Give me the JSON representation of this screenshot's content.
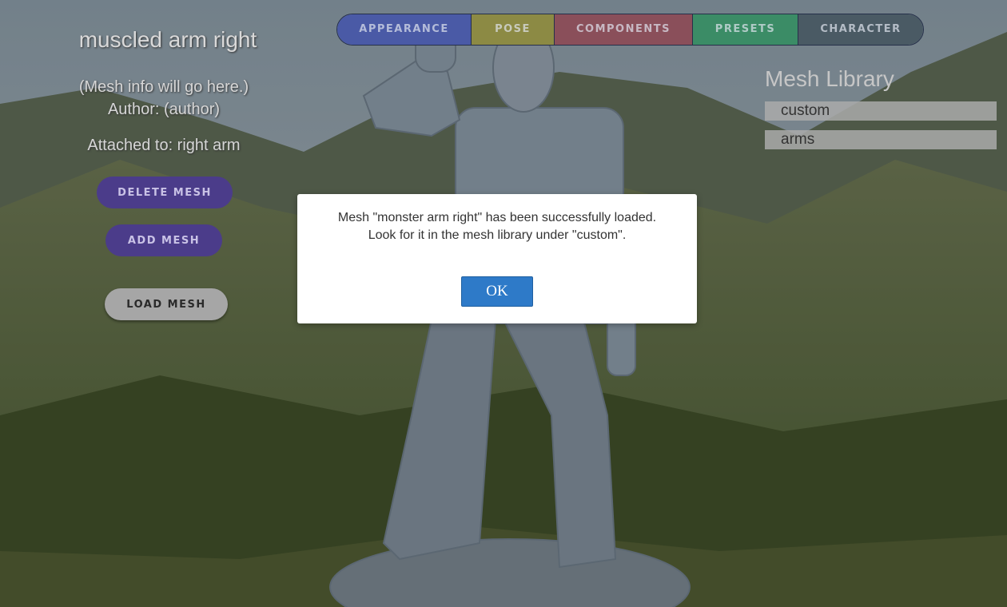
{
  "nav": {
    "tabs": [
      {
        "label": "APPEARANCE",
        "color": "#4a5aa6"
      },
      {
        "label": "POSE",
        "color": "#8c8a44"
      },
      {
        "label": "COMPONENTS",
        "color": "#8a4f5a"
      },
      {
        "label": "PRESETS",
        "color": "#3b8c66"
      },
      {
        "label": "CHARACTER",
        "color": "#4a5a64"
      }
    ]
  },
  "left_panel": {
    "title": "muscled arm right",
    "info_line1": "(Mesh info will go here.)",
    "info_line2": "Author: (author)",
    "attached": "Attached to: right arm",
    "delete_label": "DELETE MESH",
    "add_label": "ADD MESH",
    "load_label": "LOAD MESH"
  },
  "library": {
    "title": "Mesh Library",
    "items": [
      "custom",
      "arms"
    ]
  },
  "dialog": {
    "line1": "Mesh \"monster arm right\" has been successfully loaded.",
    "line2": "Look for it in the mesh library under \"custom\".",
    "ok_label": "OK"
  },
  "colors": {
    "accent_purple": "#4b3c8a",
    "ok_blue": "#2e7ac8"
  }
}
